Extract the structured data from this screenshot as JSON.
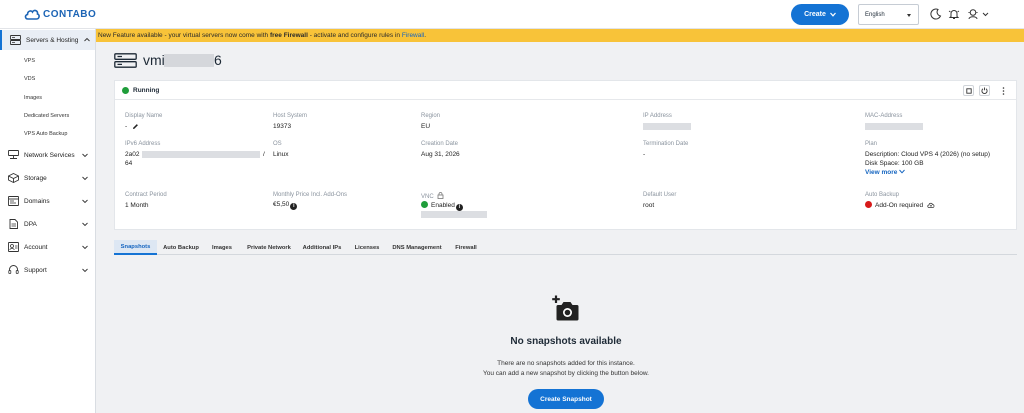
{
  "brand": {
    "name": "CONTABO",
    "color": "#1473d4"
  },
  "topbar": {
    "create_label": "Create",
    "language_selected": "English",
    "icons": [
      "moon-icon",
      "bell-icon",
      "user-support-icon",
      "chevron-down-icon"
    ]
  },
  "banner": {
    "prefix": "New Feature available - your virtual servers now come with ",
    "bold": "free Firewall",
    "middle": " - activate and configure rules in ",
    "link": "Firewall",
    "suffix": ".",
    "color": "#f8c339"
  },
  "sidebar": {
    "groups": [
      {
        "label": "Servers & Hosting",
        "icon": "server-icon",
        "expanded": true,
        "items": [
          "VPS",
          "VDS",
          "Images",
          "Dedicated Servers",
          "VPS Auto Backup"
        ]
      },
      {
        "label": "Network Services",
        "icon": "network-icon"
      },
      {
        "label": "Storage",
        "icon": "storage-icon"
      },
      {
        "label": "Domains",
        "icon": "domains-icon"
      },
      {
        "label": "DPA",
        "icon": "document-icon"
      },
      {
        "label": "Account",
        "icon": "account-icon"
      },
      {
        "label": "Support",
        "icon": "support-icon"
      }
    ]
  },
  "page": {
    "title_prefix": "vmi",
    "title_suffix": "6"
  },
  "instance": {
    "status": "Running",
    "status_color": "#1f9d3a",
    "fields": {
      "display_name": {
        "label": "Display Name",
        "value": "-"
      },
      "host_system": {
        "label": "Host System",
        "value": "19373"
      },
      "region": {
        "label": "Region",
        "value": "EU"
      },
      "ip_address": {
        "label": "IP Address"
      },
      "mac_address": {
        "label": "MAC-Address"
      },
      "ipv6": {
        "label": "IPv6 Address",
        "value_start": "2a02",
        "value_end": "/",
        "value_line2": "64"
      },
      "os": {
        "label": "OS",
        "value": "Linux"
      },
      "creation_date": {
        "label": "Creation Date",
        "value": "Aug 31, 2026"
      },
      "termination_date": {
        "label": "Termination Date",
        "value": "-"
      },
      "plan": {
        "label": "Plan",
        "description": "Description: Cloud VPS 4 (2026) (no setup)",
        "disk": "Disk Space: 100 GB",
        "view_more": "View more"
      },
      "contract_period": {
        "label": "Contract Period",
        "value": "1 Month"
      },
      "monthly_price": {
        "label": "Monthly Price Incl. Add-Ons",
        "value": "€5,50"
      },
      "vnc": {
        "label": "VNC",
        "value": "Enabled"
      },
      "default_user": {
        "label": "Default User",
        "value": "root"
      },
      "auto_backup": {
        "label": "Auto Backup",
        "value": "Add-On required"
      }
    }
  },
  "tabs": [
    "Snapshots",
    "Auto Backup",
    "Images",
    "Private Network",
    "Additional IPs",
    "Licenses",
    "DNS Management",
    "Firewall"
  ],
  "empty_state": {
    "title": "No snapshots available",
    "line1": "There are no snapshots added for this instance.",
    "line2": "You can add a new snapshot by clicking the button below.",
    "button": "Create Snapshot"
  }
}
